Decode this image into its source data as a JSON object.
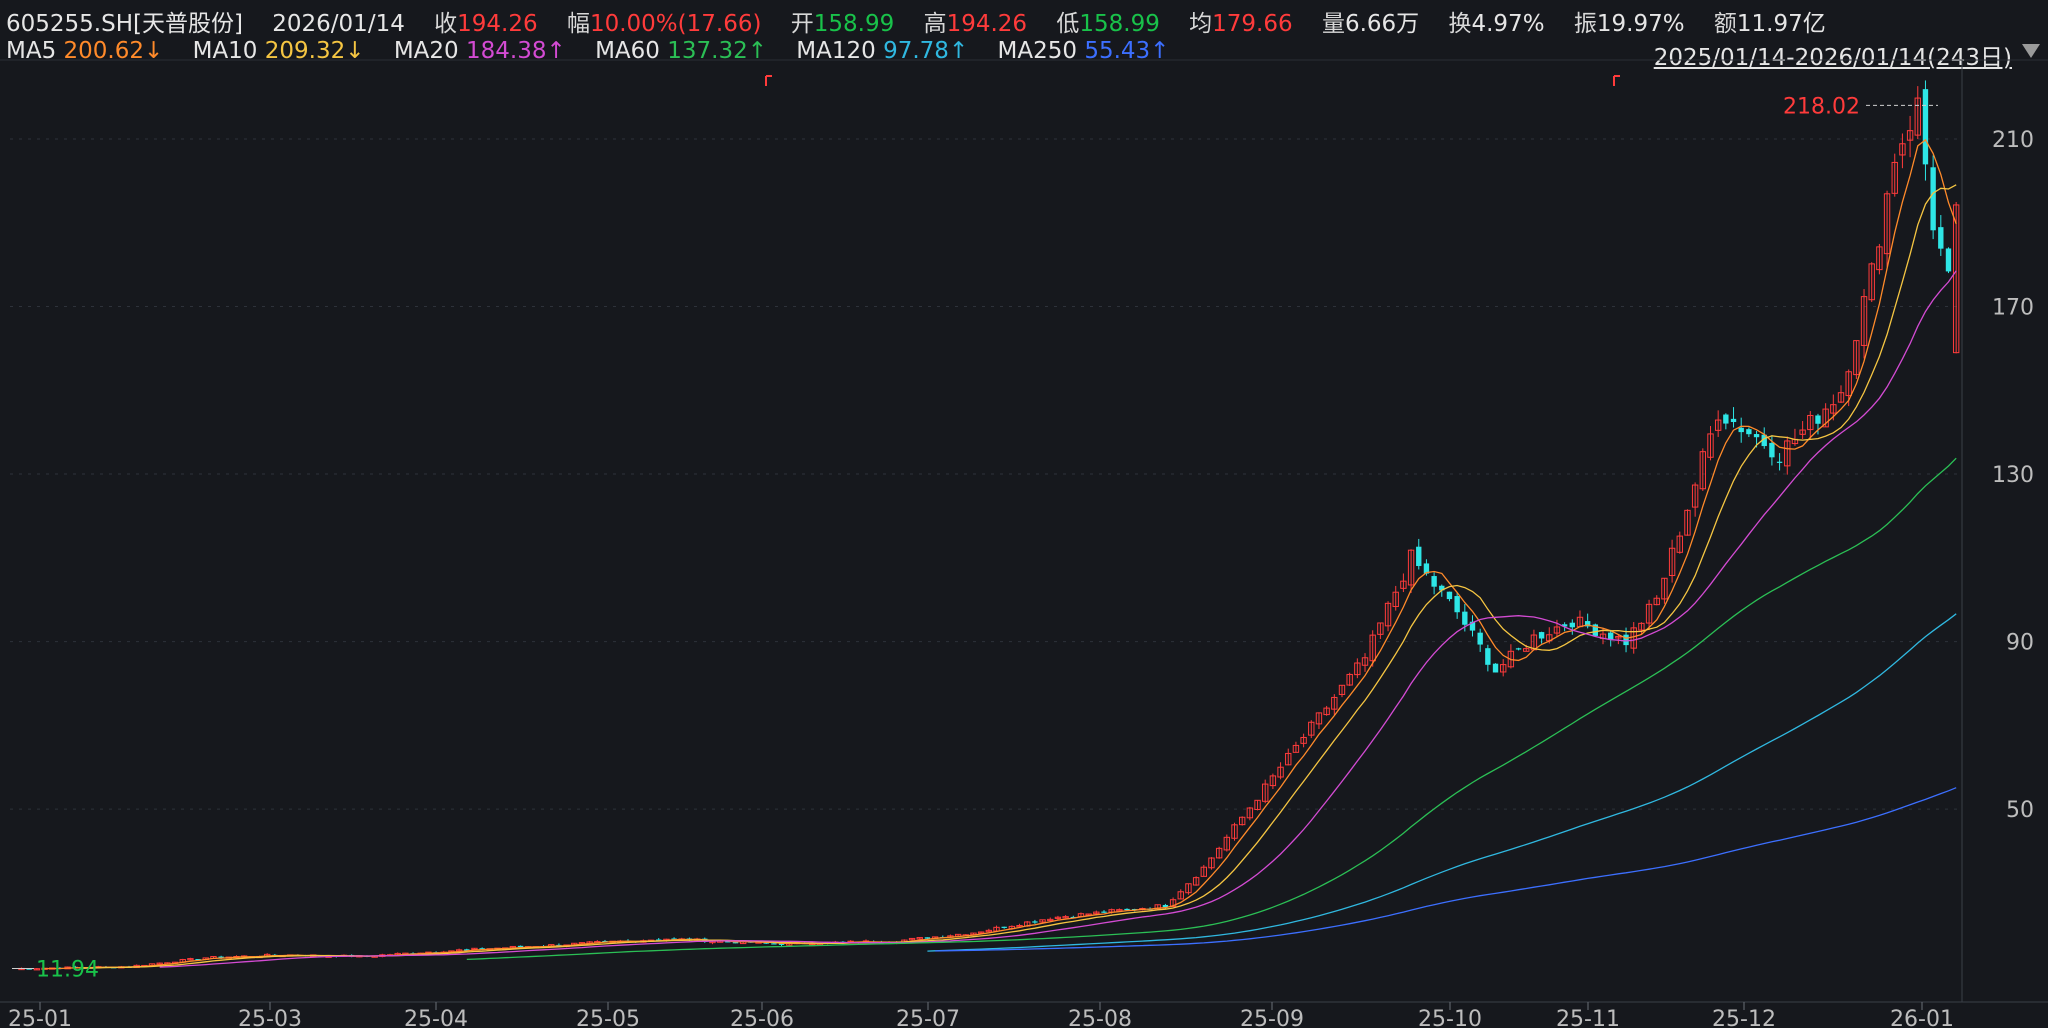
{
  "header": {
    "code": "605255.SH[天普股份]",
    "date": "2026/01/14",
    "close_label": "收",
    "close": "194.26",
    "change_label": "幅",
    "change": "10.00%(17.66)",
    "open_label": "开",
    "open": "158.99",
    "high_label": "高",
    "high": "194.26",
    "low_label": "低",
    "low": "158.99",
    "avg_label": "均",
    "avg": "179.66",
    "volume_label": "量",
    "volume": "6.66万",
    "turnover_label": "换",
    "turnover": "4.97%",
    "amplitude_label": "振",
    "amplitude": "19.97%",
    "amount_label": "额",
    "amount": "11.97亿"
  },
  "ma_row": [
    {
      "label": "MA5",
      "value": "200.62↓",
      "color": "#ff8a2a"
    },
    {
      "label": "MA10",
      "value": "209.32↓",
      "color": "#f5c542"
    },
    {
      "label": "MA20",
      "value": "184.38↑",
      "color": "#d34bd3"
    },
    {
      "label": "MA60",
      "value": "137.32↑",
      "color": "#2bbf55"
    },
    {
      "label": "MA120",
      "value": "97.78↑",
      "color": "#30b8e0"
    },
    {
      "label": "MA250",
      "value": "55.43↑",
      "color": "#3c6fff"
    }
  ],
  "range_label": "2025/01/14-2026/01/14(243日)",
  "colors": {
    "up": "#ff3b3b",
    "down": "#2ee6e6",
    "grid": "#2e323a",
    "background": "#16181d"
  },
  "chart_data": {
    "type": "candlestick",
    "y_ticks": [
      50,
      90,
      130,
      170,
      210
    ],
    "ylim": [
      8,
      226
    ],
    "x_ticks": [
      "25-01",
      "25-03",
      "25-04",
      "25-05",
      "25-06",
      "25-07",
      "25-08",
      "25-09",
      "25-10",
      "25-11",
      "25-12",
      "26-01"
    ],
    "annotations": {
      "max_label": "218.02",
      "min_label": "11.94"
    },
    "price_path": [
      [
        0,
        11.9
      ],
      [
        15,
        12.4
      ],
      [
        25,
        14.5
      ],
      [
        35,
        15.2
      ],
      [
        45,
        14.8
      ],
      [
        55,
        16.0
      ],
      [
        70,
        17.5
      ],
      [
        85,
        19.0
      ],
      [
        100,
        17.8
      ],
      [
        115,
        18.5
      ],
      [
        125,
        20.5
      ],
      [
        135,
        24.0
      ],
      [
        150,
        27.0
      ],
      [
        155,
        36.0
      ],
      [
        160,
        48.0
      ],
      [
        165,
        60.0
      ],
      [
        170,
        72.0
      ],
      [
        176,
        86.0
      ],
      [
        182,
        110.0
      ],
      [
        188,
        97.0
      ],
      [
        193,
        83.0
      ],
      [
        198,
        91.0
      ],
      [
        203,
        95.0
      ],
      [
        210,
        90.0
      ],
      [
        214,
        100.0
      ],
      [
        218,
        122.0
      ],
      [
        222,
        145.0
      ],
      [
        226,
        140.0
      ],
      [
        230,
        135.0
      ],
      [
        234,
        142.0
      ],
      [
        238,
        150.0
      ],
      [
        242,
        178.0
      ],
      [
        245,
        206.0
      ],
      [
        248,
        218.0
      ],
      [
        250,
        190.0
      ],
      [
        252,
        176.0
      ],
      [
        253,
        194.26
      ]
    ],
    "ma_end_values": {
      "MA5": 200.62,
      "MA10": 209.32,
      "MA20": 184.38,
      "MA60": 137.32,
      "MA120": 97.78,
      "MA250": 55.43
    }
  }
}
